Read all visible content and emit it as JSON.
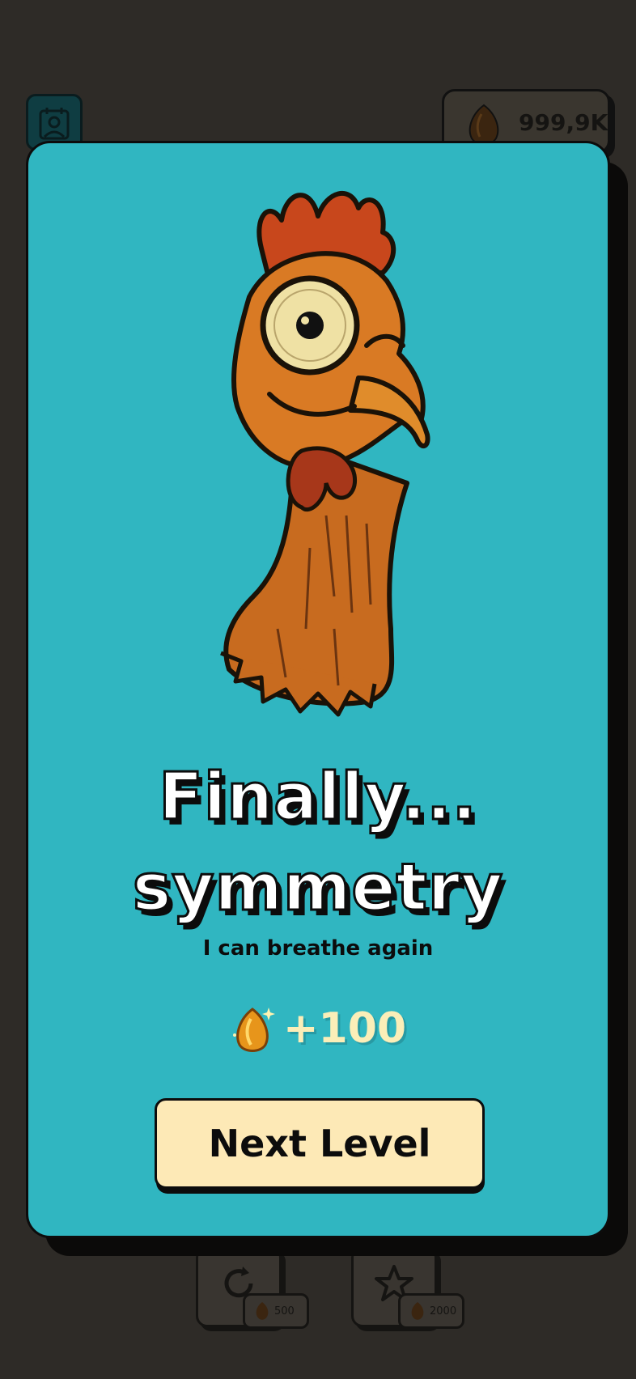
{
  "hud": {
    "coins": "999,9K"
  },
  "powerups": [
    {
      "icon": "refresh-icon",
      "cost": "500"
    },
    {
      "icon": "star-icon",
      "cost": "2000"
    }
  ],
  "modal": {
    "title_line1": "Finally...",
    "title_line2": "symmetry",
    "subtitle": "I can breathe again",
    "reward": "+100",
    "next_label": "Next Level"
  },
  "colors": {
    "modal_bg": "#30b6c1",
    "button_bg": "#fde9b6",
    "reward_text": "#fbeeb8",
    "backdrop": "#2e2b27"
  }
}
